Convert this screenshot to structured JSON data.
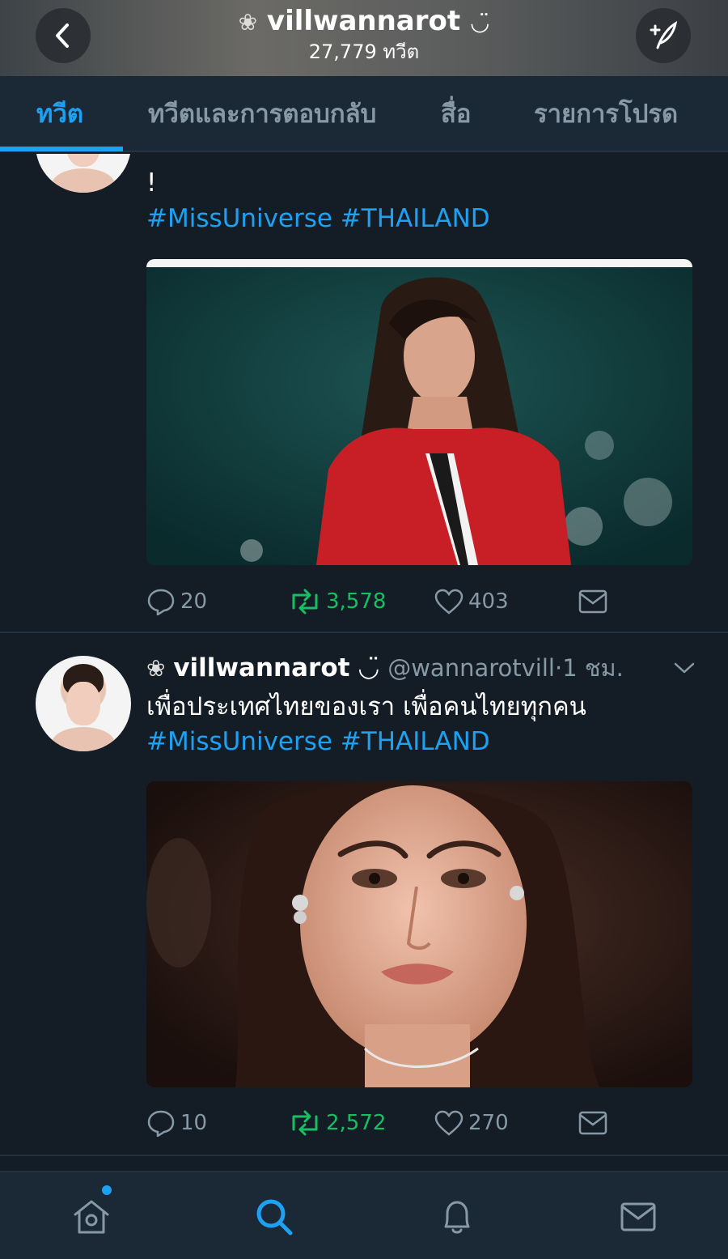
{
  "header": {
    "username": "villwannarot",
    "tweet_count": "27,779 ทวีต"
  },
  "tabs": [
    {
      "label": "ทวีต",
      "active": true
    },
    {
      "label": "ทวีตและการตอบกลับ",
      "active": false
    },
    {
      "label": "สื่อ",
      "active": false
    },
    {
      "label": "รายการโปรด",
      "active": false
    }
  ],
  "tweets": [
    {
      "text_tail": "!",
      "hashtags": "#MissUniverse #THAILAND",
      "replies": "20",
      "retweets": "3,578",
      "likes": "403"
    },
    {
      "author_name": "villwannarot",
      "author_handle": "@wannarotvill",
      "time": "1 ชม.",
      "text": "เพื่อประเทศไทยของเรา เพื่อคนไทยทุกคน",
      "hashtags": "#MissUniverse #THAILAND",
      "replies": "10",
      "retweets": "2,572",
      "likes": "270"
    }
  ],
  "colors": {
    "accent": "#1da1f2",
    "retweet": "#17bf63",
    "background": "#141d26",
    "muted": "#8899a6"
  },
  "icons": {
    "back": "chevron-left-icon",
    "compose": "compose-tweet-icon",
    "reply": "reply-icon",
    "retweet": "retweet-icon",
    "like": "heart-icon",
    "message": "direct-message-icon",
    "home": "home-icon",
    "search": "search-icon",
    "notifications": "bell-icon",
    "messages": "envelope-icon"
  }
}
